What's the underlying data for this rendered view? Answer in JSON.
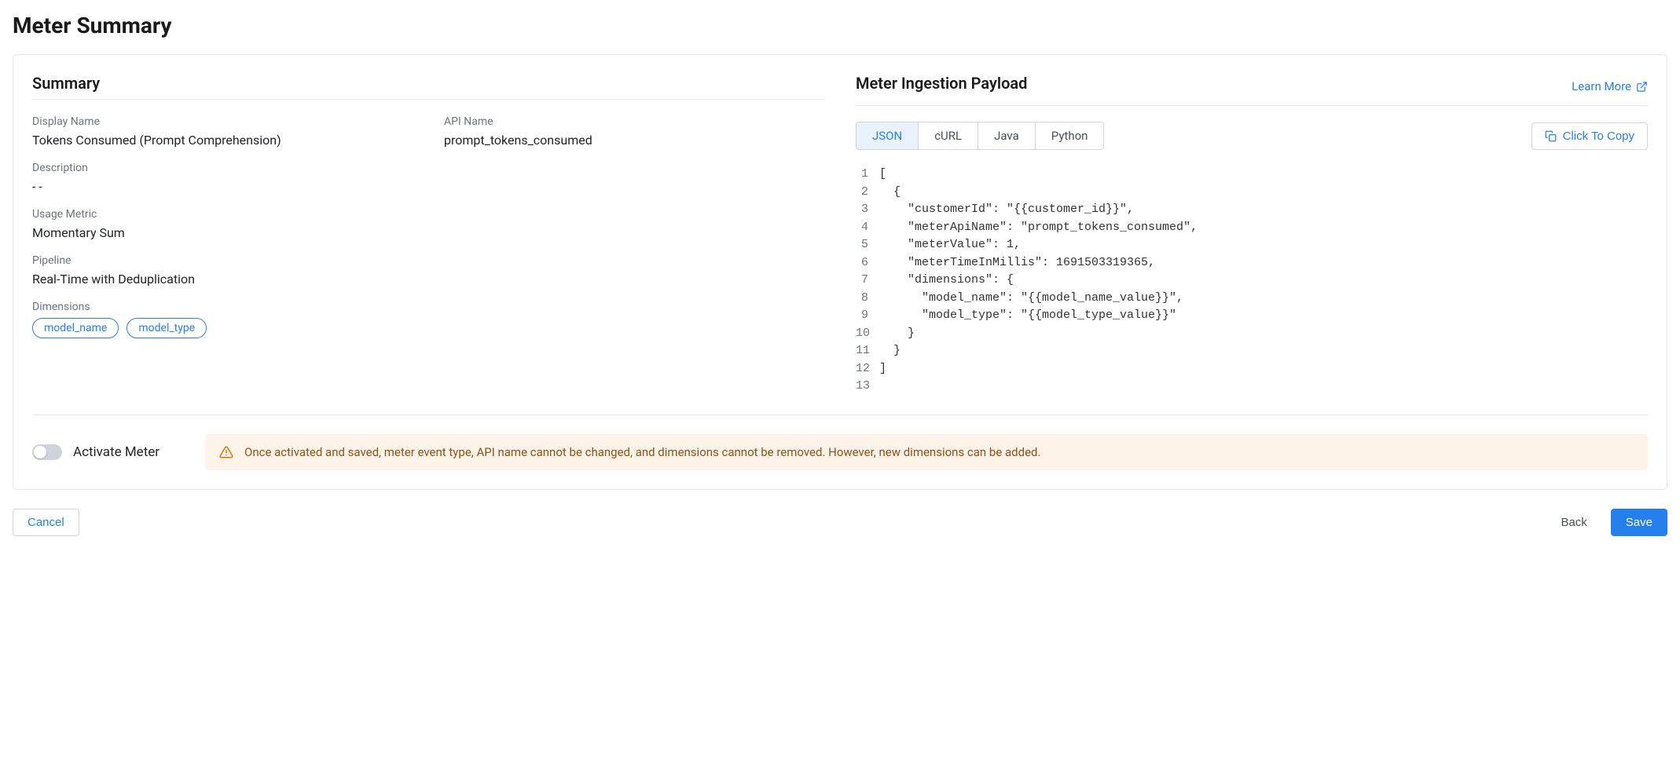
{
  "page_title": "Meter Summary",
  "summary": {
    "heading": "Summary",
    "fields": {
      "display_name": {
        "label": "Display Name",
        "value": "Tokens Consumed (Prompt Comprehension)"
      },
      "api_name": {
        "label": "API Name",
        "value": "prompt_tokens_consumed"
      },
      "description": {
        "label": "Description",
        "value": "- -"
      },
      "usage_metric": {
        "label": "Usage Metric",
        "value": "Momentary Sum"
      },
      "pipeline": {
        "label": "Pipeline",
        "value": "Real-Time with Deduplication"
      },
      "dimensions": {
        "label": "Dimensions",
        "values": [
          "model_name",
          "model_type"
        ]
      }
    }
  },
  "payload": {
    "heading": "Meter Ingestion Payload",
    "learn_more": "Learn More",
    "tabs": [
      "JSON",
      "cURL",
      "Java",
      "Python"
    ],
    "active_tab": "JSON",
    "copy_label": "Click To Copy",
    "code_lines": [
      "[",
      "  {",
      "    \"customerId\": \"{{customer_id}}\",",
      "    \"meterApiName\": \"prompt_tokens_consumed\",",
      "    \"meterValue\": 1,",
      "    \"meterTimeInMillis\": 1691503319365,",
      "    \"dimensions\": {",
      "      \"model_name\": \"{{model_name_value}}\",",
      "      \"model_type\": \"{{model_type_value}}\"",
      "    }",
      "  }",
      "]",
      ""
    ]
  },
  "activate": {
    "label": "Activate Meter",
    "warning": "Once activated and saved, meter event type, API name cannot be changed, and dimensions cannot be removed. However, new dimensions can be added."
  },
  "footer": {
    "cancel": "Cancel",
    "back": "Back",
    "save": "Save"
  }
}
